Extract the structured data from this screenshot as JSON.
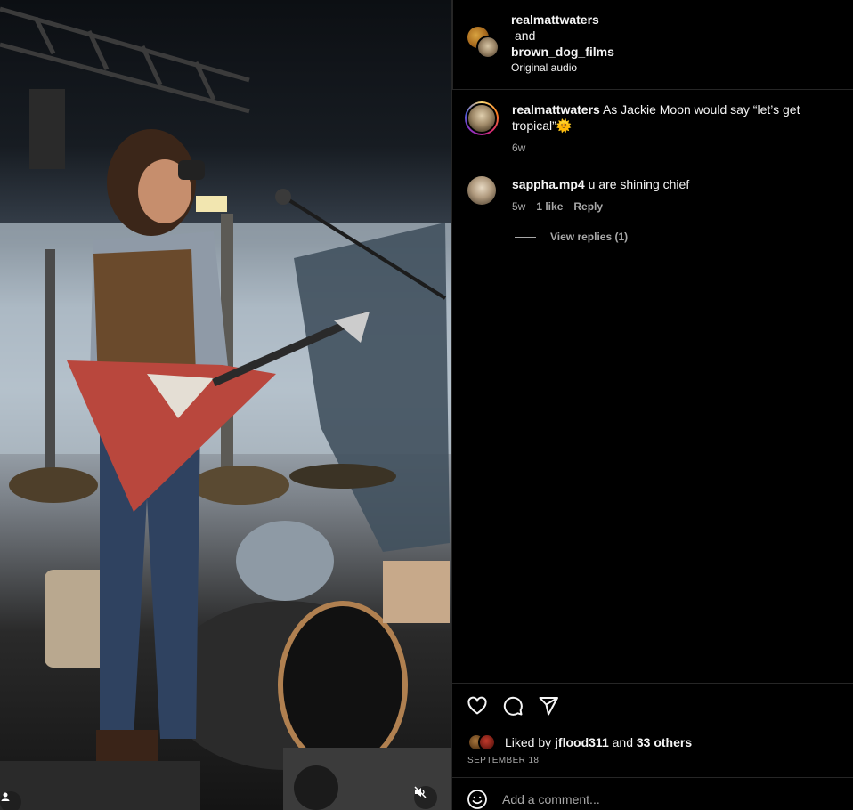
{
  "header": {
    "user1": "realmattwaters",
    "and_text": "and",
    "user2": "brown_dog_films",
    "audio": "Original audio"
  },
  "comments": [
    {
      "username": "realmattwaters",
      "text": "As Jackie Moon would say “let’s get tropical”🌞",
      "age": "6w"
    },
    {
      "username": "sappha.mp4",
      "text": "u are shining chief",
      "age": "5w",
      "likes": "1 like",
      "reply": "Reply",
      "view_replies": "View replies (1)"
    }
  ],
  "actions": {
    "like_icon": "heart-icon",
    "comment_icon": "comment-icon",
    "share_icon": "send-icon"
  },
  "likes": {
    "prefix": "Liked by",
    "user": "jflood311",
    "and": "and",
    "others": "33 others"
  },
  "date": "SEPTEMBER 18",
  "add_comment": {
    "placeholder": "Add a comment..."
  },
  "colors": {
    "background": "#000000",
    "text_primary": "#f5f5f5",
    "text_secondary": "#a8a8a8",
    "divider": "#262626"
  }
}
